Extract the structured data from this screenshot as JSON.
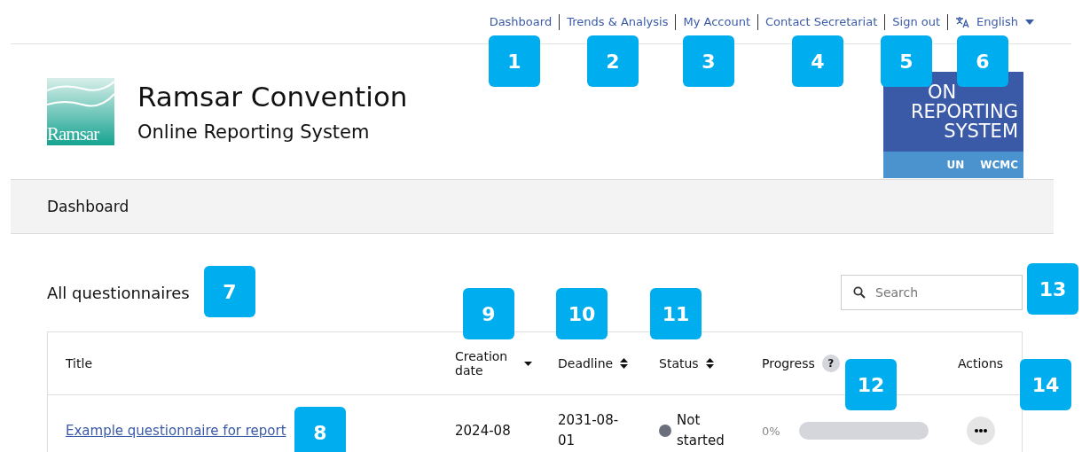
{
  "top_nav": {
    "links": [
      "Dashboard",
      "Trends & Analysis",
      "My Account",
      "Contact Secretariat",
      "Sign out"
    ],
    "language": "English"
  },
  "header": {
    "title": "Ramsar Convention",
    "subtitle": "Online Reporting System",
    "logo_word": "Ramsar",
    "badge_lines": [
      "ON",
      "REPORTING",
      "SYSTEM"
    ],
    "badge_footer": [
      "UN",
      "WCMC"
    ]
  },
  "breadcrumb": "Dashboard",
  "section_title": "All questionnaires",
  "search": {
    "placeholder": "Search"
  },
  "table": {
    "columns": [
      {
        "label": "Title",
        "kind": "plain"
      },
      {
        "label": "Creation date",
        "kind": "desc"
      },
      {
        "label": "Deadline",
        "kind": "sortable"
      },
      {
        "label": "Status",
        "kind": "sortable"
      },
      {
        "label": "Progress",
        "kind": "help",
        "help": "?"
      },
      {
        "label": "Actions",
        "kind": "plain"
      }
    ],
    "rows": [
      {
        "title": "Example questionnaire for report",
        "created": "2024-08",
        "deadline": "2031-08-01",
        "status": "Not started",
        "color": "#6b6f7b",
        "percent": "0%",
        "level": 0
      }
    ]
  },
  "callouts": [
    "1",
    "2",
    "3",
    "4",
    "5",
    "6",
    "7",
    "8",
    "9",
    "10",
    "11",
    "12",
    "13",
    "14"
  ]
}
